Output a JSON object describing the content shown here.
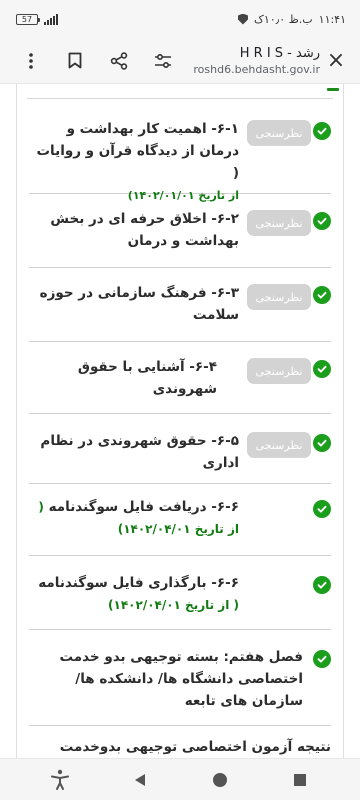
{
  "status_bar": {
    "battery": "57",
    "time": "۱۱:۴۱",
    "ampm": "ب.ظ ۱۰٫۰ک"
  },
  "browser": {
    "title": "رشد - H R I S",
    "url": "roshd6.behdasht.gov.ir"
  },
  "lessons": [
    {
      "text": "۶-۱- اهمیت کار بهداشت و درمان از دیدگاه قرآن و روایات (",
      "date": "از تاریخ ۱۴۰۲/۰۱/۰۱)",
      "survey": "نظرسنجی"
    },
    {
      "text": "۶-۲- اخلاق حرفه ای در بخش بهداشت و درمان",
      "survey": "نظرسنجی"
    },
    {
      "text": "۶-۳- فرهنگ سازمانی در حوزه سلامت",
      "survey": "نظرسنجی"
    },
    {
      "text": "۶-۴- آشنایی با حقوق شهروندی",
      "survey": "نظرسنجی"
    },
    {
      "text": "۶-۵- حقوق شهروندی در نظام اداری",
      "survey": "نظرسنجی"
    },
    {
      "text": "۶-۶- دریافت فایل سوگندنامه",
      "date": "( از تاریخ ۱۴۰۲/۰۴/۰۱)"
    },
    {
      "text": "۶-۶- بارگذاری فایل سوگندنامه",
      "date": "( از تاریخ ۱۴۰۲/۰۴/۰۱)"
    },
    {
      "text": "فصل هفتم: بسته توجیهی بدو خدمت اختصاصی دانشگاه ها/ دانشکده ها/سازمان های تابعه"
    },
    {
      "text": "نتیجه آزمون اختصاصی توجیهی بدوخدمت"
    }
  ],
  "colors": {
    "check_green": "#1b9e1b",
    "date_green": "#117a11",
    "survey_button": "#d3d3d3"
  }
}
